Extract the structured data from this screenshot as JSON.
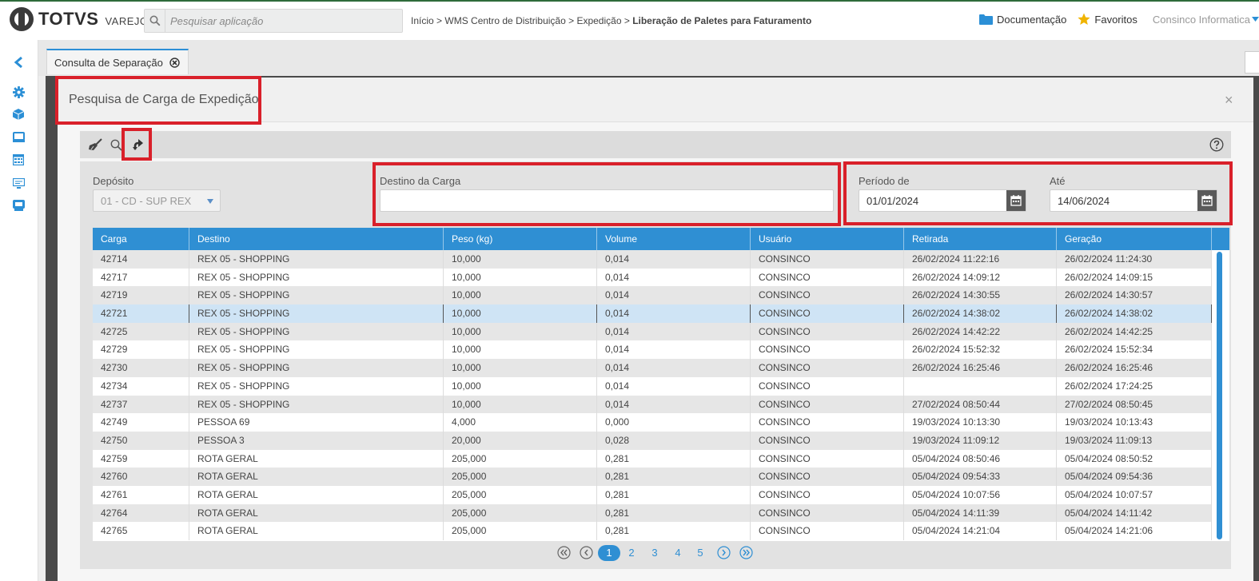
{
  "header": {
    "brand": "TOTVS",
    "brand_sub": "VAREJO",
    "search_placeholder": "Pesquisar aplicação",
    "breadcrumb": [
      "Início",
      "WMS Centro de Distribuição",
      "Expedição"
    ],
    "breadcrumb_current": "Liberação de Paletes para Faturamento",
    "breadcrumb_sep": " > ",
    "documentation": "Documentação",
    "favorites": "Favoritos",
    "user": "Consinco Informatica"
  },
  "leftnav": {
    "icons": [
      "chevron-left-icon",
      "gear-icon",
      "cube-icon",
      "screen-icon",
      "calendar-grid-icon",
      "monitor-icon",
      "database-icon"
    ]
  },
  "tab": {
    "label": "Consulta de Separação"
  },
  "modal": {
    "title": "Pesquisa de Carga de Expedição",
    "close": "×",
    "toolbar": {
      "icons": [
        "broom-icon",
        "search-icon",
        "return-icon",
        "help-icon"
      ]
    },
    "filters": {
      "deposito_label": "Depósito",
      "deposito_value": "01 - CD - SUP REX",
      "destino_label": "Destino da Carga",
      "destino_value": "",
      "periodo_de_label": "Período de",
      "periodo_de_value": "01/01/2024",
      "ate_label": "Até",
      "ate_value": "14/06/2024"
    },
    "grid": {
      "columns": [
        "Carga",
        "Destino",
        "Peso (kg)",
        "Volume",
        "Usuário",
        "Retirada",
        "Geração"
      ],
      "selected_row": 3,
      "rows": [
        [
          "42714",
          "REX 05 - SHOPPING",
          "10,000",
          "0,014",
          "CONSINCO",
          "26/02/2024 11:22:16",
          "26/02/2024 11:24:30"
        ],
        [
          "42717",
          "REX 05 - SHOPPING",
          "10,000",
          "0,014",
          "CONSINCO",
          "26/02/2024 14:09:12",
          "26/02/2024 14:09:15"
        ],
        [
          "42719",
          "REX 05 - SHOPPING",
          "10,000",
          "0,014",
          "CONSINCO",
          "26/02/2024 14:30:55",
          "26/02/2024 14:30:57"
        ],
        [
          "42721",
          "REX 05 - SHOPPING",
          "10,000",
          "0,014",
          "CONSINCO",
          "26/02/2024 14:38:02",
          "26/02/2024 14:38:02"
        ],
        [
          "42725",
          "REX 05 - SHOPPING",
          "10,000",
          "0,014",
          "CONSINCO",
          "26/02/2024 14:42:22",
          "26/02/2024 14:42:25"
        ],
        [
          "42729",
          "REX 05 - SHOPPING",
          "10,000",
          "0,014",
          "CONSINCO",
          "26/02/2024 15:52:32",
          "26/02/2024 15:52:34"
        ],
        [
          "42730",
          "REX 05 - SHOPPING",
          "10,000",
          "0,014",
          "CONSINCO",
          "26/02/2024 16:25:46",
          "26/02/2024 16:25:46"
        ],
        [
          "42734",
          "REX 05 - SHOPPING",
          "10,000",
          "0,014",
          "CONSINCO",
          "",
          "26/02/2024 17:24:25"
        ],
        [
          "42737",
          "REX 05 - SHOPPING",
          "10,000",
          "0,014",
          "CONSINCO",
          "27/02/2024 08:50:44",
          "27/02/2024 08:50:45"
        ],
        [
          "42749",
          "PESSOA 69",
          "4,000",
          "0,000",
          "CONSINCO",
          "19/03/2024 10:13:30",
          "19/03/2024 10:13:43"
        ],
        [
          "42750",
          "PESSOA 3",
          "20,000",
          "0,028",
          "CONSINCO",
          "19/03/2024 11:09:12",
          "19/03/2024 11:09:13"
        ],
        [
          "42759",
          "ROTA GERAL",
          "205,000",
          "0,281",
          "CONSINCO",
          "05/04/2024 08:50:46",
          "05/04/2024 08:50:52"
        ],
        [
          "42760",
          "ROTA GERAL",
          "205,000",
          "0,281",
          "CONSINCO",
          "05/04/2024 09:54:33",
          "05/04/2024 09:54:36"
        ],
        [
          "42761",
          "ROTA GERAL",
          "205,000",
          "0,281",
          "CONSINCO",
          "05/04/2024 10:07:56",
          "05/04/2024 10:07:57"
        ],
        [
          "42764",
          "ROTA GERAL",
          "205,000",
          "0,281",
          "CONSINCO",
          "05/04/2024 14:11:39",
          "05/04/2024 14:11:42"
        ],
        [
          "42765",
          "ROTA GERAL",
          "205,000",
          "0,281",
          "CONSINCO",
          "05/04/2024 14:21:04",
          "05/04/2024 14:21:06"
        ]
      ]
    },
    "pager": {
      "pages": [
        "1",
        "2",
        "3",
        "4",
        "5"
      ],
      "current": "1"
    }
  },
  "colors": {
    "accent": "#2f8fd3",
    "highlight": "#d9202a",
    "selected_row": "#cfe4f5",
    "star": "#f0b400",
    "folder": "#2b8fd6"
  }
}
